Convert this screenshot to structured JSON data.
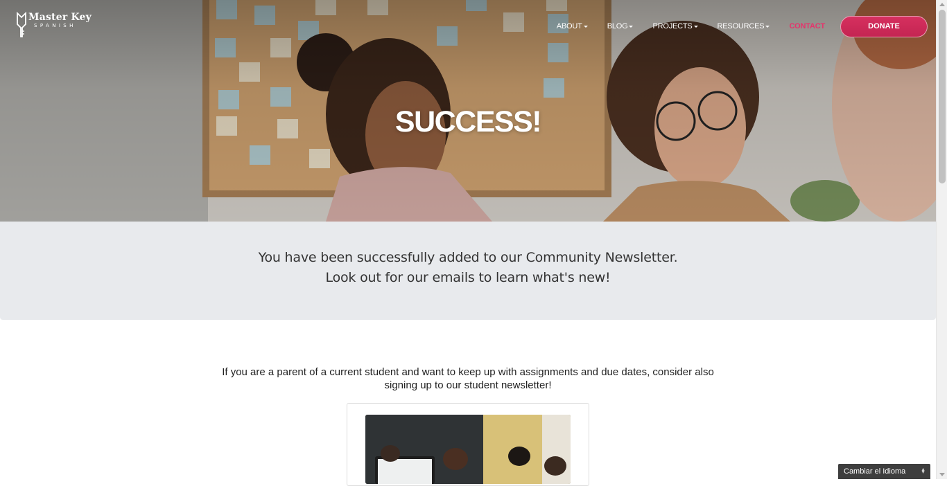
{
  "brand": {
    "logo_title": "Master Key",
    "logo_subtitle": "SPANISH",
    "icon": "key-icon"
  },
  "nav": {
    "items": [
      {
        "label": "ABOUT",
        "has_dropdown": true
      },
      {
        "label": "BLOG",
        "has_dropdown": true
      },
      {
        "label": "PROJECTS",
        "has_dropdown": true
      },
      {
        "label": "RESOURCES",
        "has_dropdown": true
      },
      {
        "label": "CONTACT",
        "has_dropdown": false
      }
    ],
    "donate_label": "DONATE"
  },
  "hero": {
    "title": "SUCCESS!"
  },
  "confirmation": {
    "line1": "You have been successfully added to our Community Newsletter.",
    "line2": "Look out for our emails to learn what's new!"
  },
  "parent_note": {
    "text": "If you are a parent of a current student and want to keep up with assignments and due dates, consider also signing up to our student newsletter!"
  },
  "language_widget": {
    "label": "Cambiar el Idioma"
  },
  "colors": {
    "accent": "#e6336b",
    "donate_button": "#d02e5b",
    "band_background": "#e8eaed",
    "language_widget": "#3e3e3e"
  }
}
